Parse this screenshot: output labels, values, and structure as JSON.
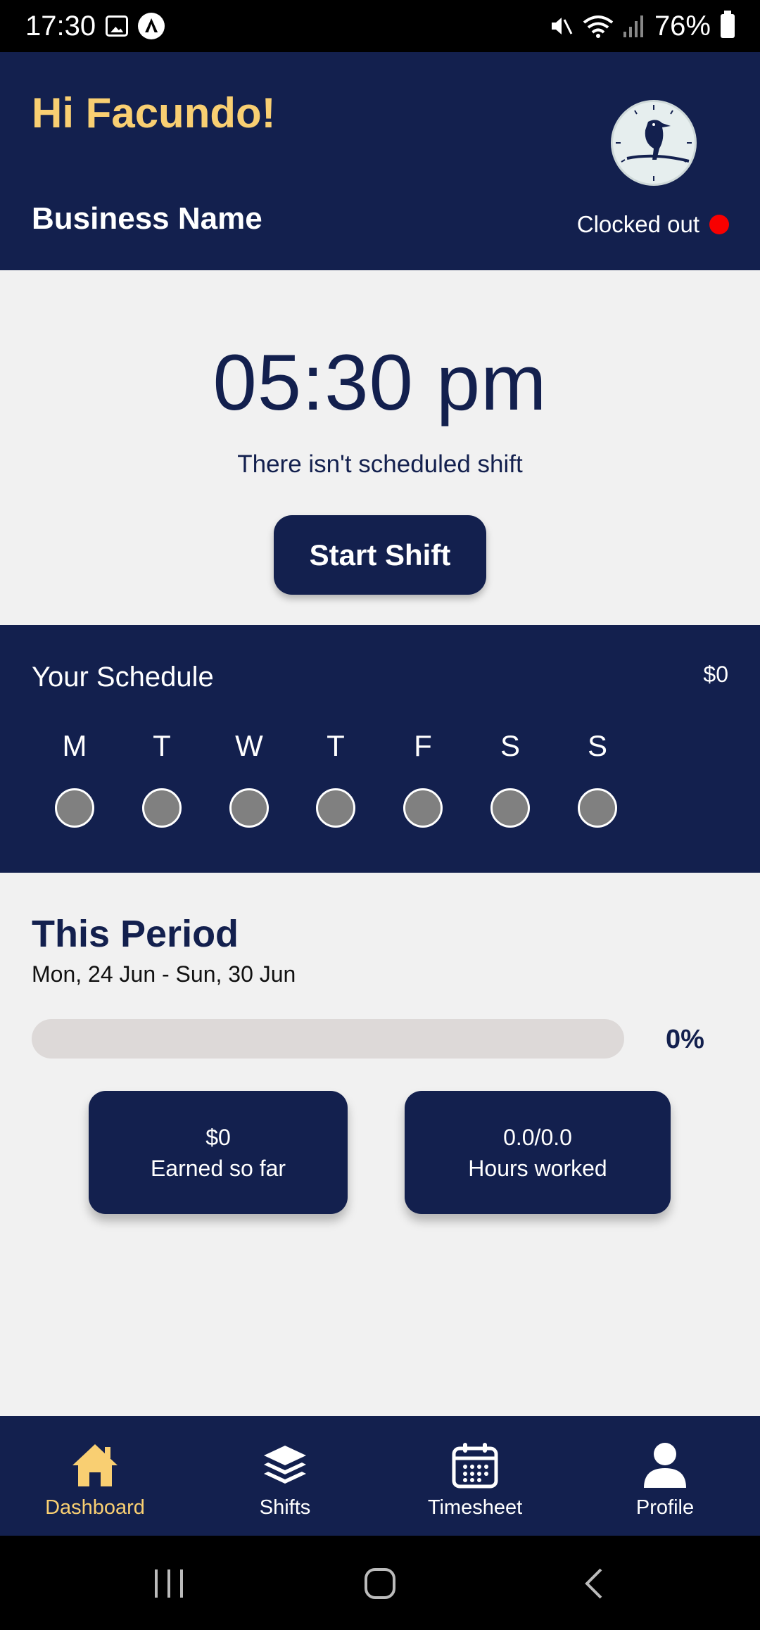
{
  "status_bar": {
    "time": "17:30",
    "battery": "76%"
  },
  "header": {
    "greeting": "Hi Facundo!",
    "business_name": "Business Name",
    "clock_status": "Clocked out"
  },
  "clock": {
    "time": "05:30 pm",
    "message": "There isn't scheduled shift",
    "start_label": "Start Shift"
  },
  "schedule": {
    "title": "Your Schedule",
    "amount": "$0",
    "days": [
      "M",
      "T",
      "W",
      "T",
      "F",
      "S",
      "S"
    ]
  },
  "period": {
    "title": "This Period",
    "range": "Mon, 24 Jun - Sun, 30 Jun",
    "progress_percent": 0,
    "progress_label": "0%",
    "earned_value": "$0",
    "earned_label": "Earned so far",
    "hours_value": "0.0/0.0",
    "hours_label": "Hours worked"
  },
  "nav": {
    "dashboard": "Dashboard",
    "shifts": "Shifts",
    "timesheet": "Timesheet",
    "profile": "Profile"
  },
  "colors": {
    "navy": "#13204e",
    "accent": "#f9cf72",
    "status_red": "#f80000"
  }
}
